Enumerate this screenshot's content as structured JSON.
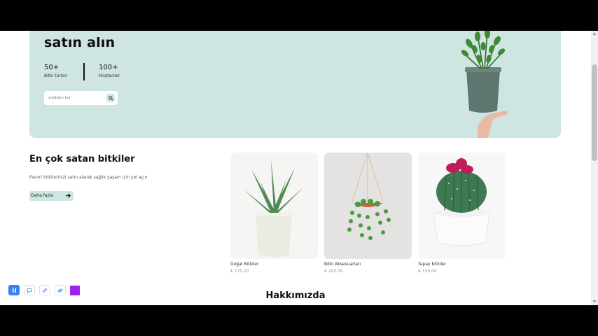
{
  "hero": {
    "title": "satın alın",
    "stats": [
      {
        "value": "50+",
        "label": "Bitki türleri"
      },
      {
        "value": "100+",
        "label": "Müşteriler"
      }
    ],
    "search": {
      "placeholder": "aradığını bul"
    }
  },
  "bestsellers": {
    "title": "En çok satan bitkiler",
    "description": "Favori bitkilerinizi satın alarak sağlık yaşam için yol açın",
    "button_label": "Daha fazla",
    "products": [
      {
        "name": "Doğal Bitkiler",
        "price": "₺ 170.00"
      },
      {
        "name": "Bitki Aksesuarları",
        "price": "₺ 200.00"
      },
      {
        "name": "Yapay bitkiler",
        "price": "₺ 159.00"
      }
    ]
  },
  "about": {
    "title": "Hakkımızda"
  },
  "colors": {
    "accent": "#cfe5e2",
    "toolbar_active": "#3b82f6",
    "swatch": "#a020f0"
  },
  "toolbar": {
    "icons": [
      "pause-icon",
      "comment-icon",
      "pen-icon",
      "link-icon",
      "color-swatch"
    ]
  }
}
